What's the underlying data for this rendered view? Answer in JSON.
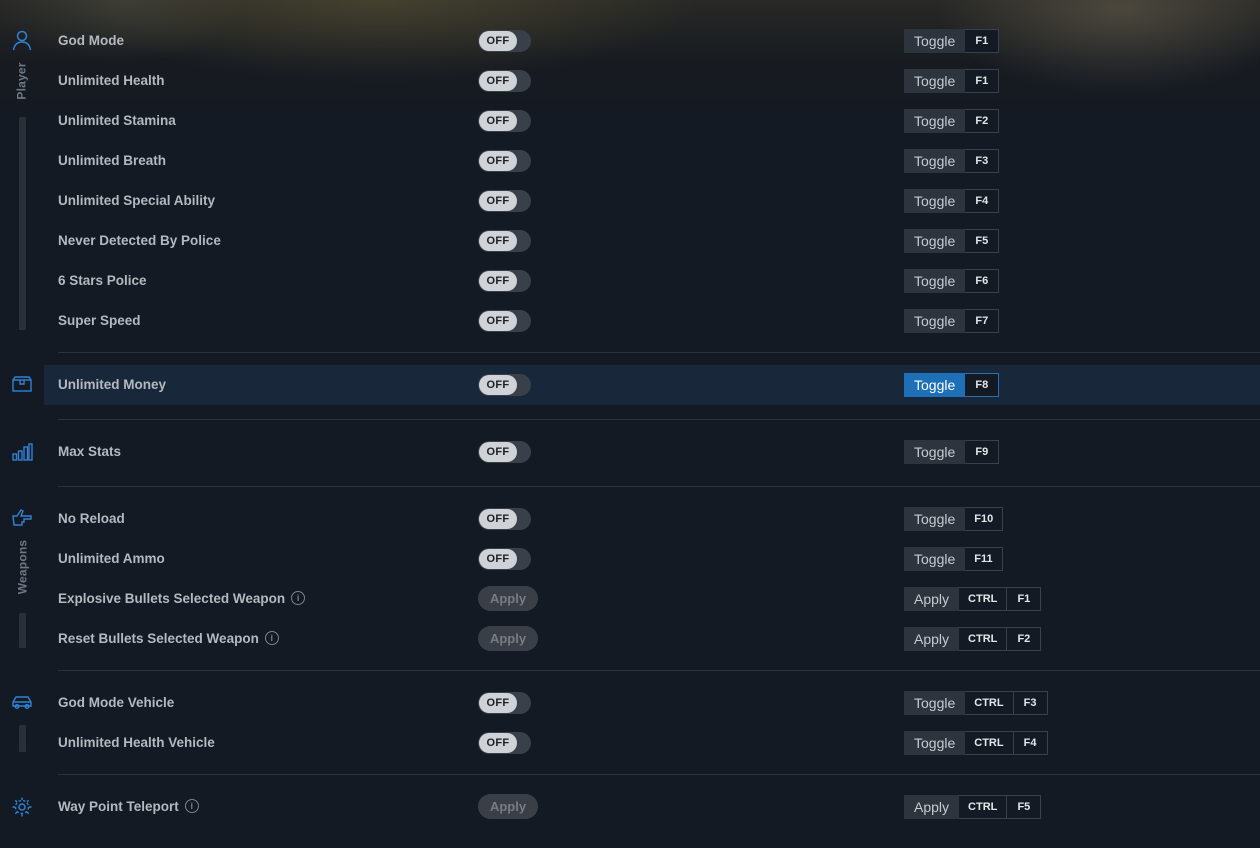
{
  "sections": [
    {
      "label": "Player",
      "icon": "player-icon",
      "rows": [
        {
          "name": "God Mode",
          "control": "toggle",
          "state": "OFF",
          "action": "Toggle",
          "keys": [
            "F1"
          ]
        },
        {
          "name": "Unlimited Health",
          "control": "toggle",
          "state": "OFF",
          "action": "Toggle",
          "keys": [
            "F1"
          ]
        },
        {
          "name": "Unlimited Stamina",
          "control": "toggle",
          "state": "OFF",
          "action": "Toggle",
          "keys": [
            "F2"
          ]
        },
        {
          "name": "Unlimited Breath",
          "control": "toggle",
          "state": "OFF",
          "action": "Toggle",
          "keys": [
            "F3"
          ]
        },
        {
          "name": "Unlimited Special Ability",
          "control": "toggle",
          "state": "OFF",
          "action": "Toggle",
          "keys": [
            "F4"
          ]
        },
        {
          "name": "Never Detected By Police",
          "control": "toggle",
          "state": "OFF",
          "action": "Toggle",
          "keys": [
            "F5"
          ]
        },
        {
          "name": "6 Stars Police",
          "control": "toggle",
          "state": "OFF",
          "action": "Toggle",
          "keys": [
            "F6"
          ]
        },
        {
          "name": "Super Speed",
          "control": "toggle",
          "state": "OFF",
          "action": "Toggle",
          "keys": [
            "F7"
          ]
        }
      ]
    },
    {
      "label": "",
      "icon": "inventory-box-icon",
      "rows": [
        {
          "name": "Unlimited Money",
          "control": "toggle",
          "state": "OFF",
          "action": "Toggle",
          "keys": [
            "F8"
          ],
          "highlighted": true
        }
      ]
    },
    {
      "label": "",
      "icon": "stats-bars-icon",
      "rows": [
        {
          "name": "Max Stats",
          "control": "toggle",
          "state": "OFF",
          "action": "Toggle",
          "keys": [
            "F9"
          ]
        }
      ]
    },
    {
      "label": "Weapons",
      "icon": "hand-gun-icon",
      "rows": [
        {
          "name": "No Reload",
          "control": "toggle",
          "state": "OFF",
          "action": "Toggle",
          "keys": [
            "F10"
          ]
        },
        {
          "name": "Unlimited Ammo",
          "control": "toggle",
          "state": "OFF",
          "action": "Toggle",
          "keys": [
            "F11"
          ]
        },
        {
          "name": "Explosive Bullets Selected Weapon",
          "info": true,
          "control": "apply",
          "button": "Apply",
          "action": "Apply",
          "keys": [
            "CTRL",
            "F1"
          ]
        },
        {
          "name": "Reset Bullets Selected Weapon",
          "info": true,
          "control": "apply",
          "button": "Apply",
          "action": "Apply",
          "keys": [
            "CTRL",
            "F2"
          ]
        }
      ]
    },
    {
      "label": "",
      "icon": "car-icon",
      "rows": [
        {
          "name": "God Mode Vehicle",
          "control": "toggle",
          "state": "OFF",
          "action": "Toggle",
          "keys": [
            "CTRL",
            "F3"
          ]
        },
        {
          "name": "Unlimited Health Vehicle",
          "control": "toggle",
          "state": "OFF",
          "action": "Toggle",
          "keys": [
            "CTRL",
            "F4"
          ]
        }
      ]
    },
    {
      "label": "",
      "icon": "teleport-icon",
      "rows": [
        {
          "name": "Way Point Teleport",
          "info": true,
          "control": "apply",
          "button": "Apply",
          "action": "Apply",
          "keys": [
            "CTRL",
            "F5"
          ]
        }
      ]
    }
  ],
  "colors": {
    "background": "#141a23",
    "accent": "#1d6fb8",
    "icon": "#2f82d6",
    "highlight_row": "#18283a"
  }
}
